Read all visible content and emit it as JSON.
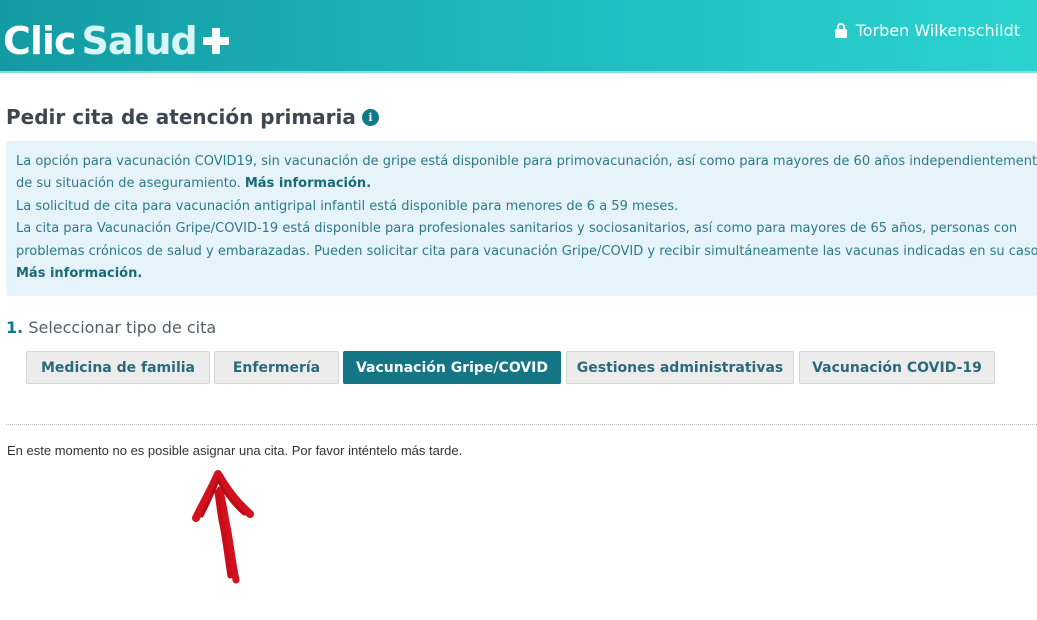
{
  "header": {
    "logo": {
      "part1": "Clic",
      "part2": "Salud"
    },
    "user_name": "Torben Wilkenschildt",
    "lock_icon": "lock-icon"
  },
  "page": {
    "title": "Pedir cita de atención primaria",
    "info_icon_glyph": "i"
  },
  "notice": {
    "p1_text": "La opción para vacunación COVID19, sin vacunación de gripe está disponible para primovacunación, así como para mayores de 60 años independientemente",
    "p1_text_cont": "de su situación de aseguramiento.",
    "p1_link": "Más información.",
    "p2_text": "La solicitud de cita para vacunación antigripal infantil está disponible para menores de 6 a 59 meses.",
    "p3_text1": "La cita para Vacunación Gripe/COVID-19 está disponible para profesionales sanitarios y sociosanitarios, así como para mayores de 65 años, personas con",
    "p3_text2": "problemas crónicos de salud y embarazadas. Pueden solicitar cita para vacunación Gripe/COVID y recibir simultáneamente las vacunas indicadas en su caso.",
    "p3_link": "Más información."
  },
  "step": {
    "number": "1.",
    "label": "Seleccionar tipo de cita"
  },
  "tabs": [
    {
      "label": "Medicina de familia",
      "active": false
    },
    {
      "label": "Enfermería",
      "active": false
    },
    {
      "label": "Vacunación Gripe/COVID",
      "active": true
    },
    {
      "label": "Gestiones administrativas",
      "active": false
    },
    {
      "label": "Vacunación COVID-19",
      "active": false
    }
  ],
  "message": "En este momento no es posible asignar una cita. Por favor inténtelo más tarde.",
  "colors": {
    "accent": "#147684",
    "header_from": "#149aa3",
    "header_to": "#2bd3cf",
    "notice_bg": "#e7f3fa",
    "arrow": "#d3101e"
  }
}
